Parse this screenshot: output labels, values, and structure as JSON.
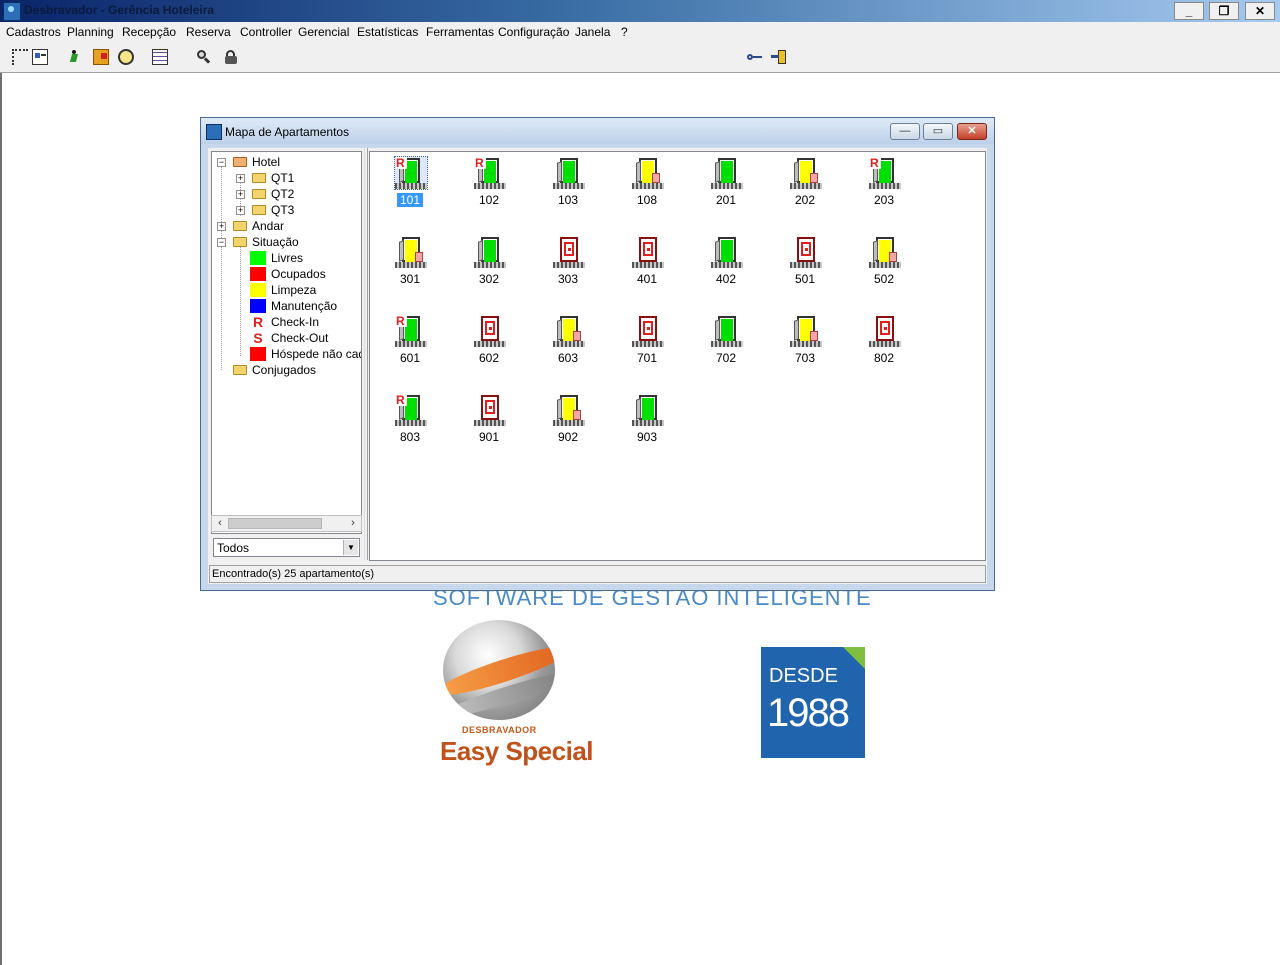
{
  "app": {
    "title": "Desbravador - Gerência Hoteleira",
    "window_buttons": {
      "minimize": "_",
      "restore": "❐",
      "close": "✕"
    }
  },
  "menu": {
    "items": [
      "Cadastros",
      "Planning",
      "Recepção",
      "Reserva",
      "Controller",
      "Gerencial",
      "Estatísticas",
      "Ferramentas",
      "Configuração",
      "Janela",
      "?"
    ]
  },
  "toolbar": {
    "icons": [
      "tree-view-icon",
      "card-icon",
      "running-man-icon",
      "exit-door-icon",
      "globe-icon",
      "calendar-icon",
      "search-user-icon",
      "lock-icon",
      "key-icon",
      "logout-icon"
    ]
  },
  "background": {
    "tagline": "SOFTWARE DE GESTÃO INTELIGENTE",
    "brand_small": "DESBRAVADOR",
    "brand_name": "Easy Special",
    "since_word": "DESDE",
    "since_year": "1988"
  },
  "child_window": {
    "title": "Mapa de Apartamentos",
    "buttons": {
      "minimize": "—",
      "restore": "▭",
      "close": "✕"
    },
    "tree": {
      "hotel": "Hotel",
      "qt1": "QT1",
      "qt2": "QT2",
      "qt3": "QT3",
      "andar": "Andar",
      "situacao": "Situação",
      "legend": [
        {
          "label": "Livres",
          "color": "#00ff00"
        },
        {
          "label": "Ocupados",
          "color": "#ff0000"
        },
        {
          "label": "Limpeza",
          "color": "#ffff00"
        },
        {
          "label": "Manutenção",
          "color": "#0000ff"
        },
        {
          "label": "Check-In",
          "glyph": "R"
        },
        {
          "label": "Check-Out",
          "glyph": "S"
        },
        {
          "label": "Hóspede não cada",
          "color": "#ff0000"
        }
      ],
      "conjugados": "Conjugados"
    },
    "filter": {
      "selected": "Todos"
    },
    "apartments": [
      {
        "number": "101",
        "status": "livre",
        "checkin": true,
        "selected": true
      },
      {
        "number": "102",
        "status": "livre",
        "checkin": true
      },
      {
        "number": "103",
        "status": "livre"
      },
      {
        "number": "108",
        "status": "limpeza",
        "guest": true
      },
      {
        "number": "201",
        "status": "livre"
      },
      {
        "number": "202",
        "status": "limpeza",
        "guest": true
      },
      {
        "number": "203",
        "status": "livre",
        "checkin": true
      },
      {
        "number": "301",
        "status": "limpeza",
        "guest": true
      },
      {
        "number": "302",
        "status": "livre"
      },
      {
        "number": "303",
        "status": "ocupado"
      },
      {
        "number": "401",
        "status": "ocupado"
      },
      {
        "number": "402",
        "status": "livre"
      },
      {
        "number": "501",
        "status": "ocupado"
      },
      {
        "number": "502",
        "status": "limpeza",
        "guest": true
      },
      {
        "number": "601",
        "status": "livre",
        "checkin": true
      },
      {
        "number": "602",
        "status": "ocupado"
      },
      {
        "number": "603",
        "status": "limpeza",
        "guest": true
      },
      {
        "number": "701",
        "status": "ocupado"
      },
      {
        "number": "702",
        "status": "livre"
      },
      {
        "number": "703",
        "status": "limpeza",
        "guest": true
      },
      {
        "number": "802",
        "status": "ocupado"
      },
      {
        "number": "803",
        "status": "livre",
        "checkin": true
      },
      {
        "number": "901",
        "status": "ocupado"
      },
      {
        "number": "902",
        "status": "limpeza",
        "guest": true
      },
      {
        "number": "903",
        "status": "livre"
      }
    ],
    "status_text": "Encontrado(s) 25 apartamento(s)"
  }
}
